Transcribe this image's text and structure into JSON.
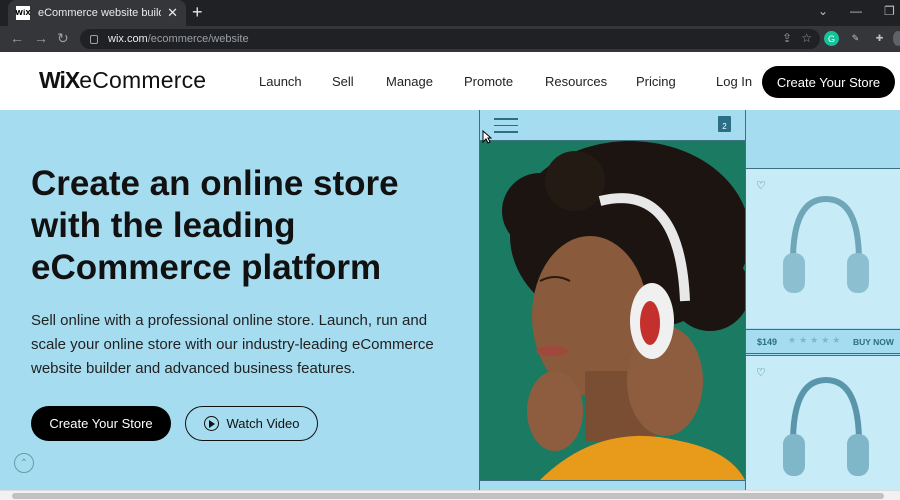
{
  "browser": {
    "tab_title": "eCommerce website builder | Cre",
    "favicon_text": "WiX",
    "tab_close": "✕",
    "new_tab": "+",
    "url_host": "wix.com",
    "url_path": "/ecommerce/website"
  },
  "header": {
    "logo_wix": "WiX",
    "logo_product": "eCommerce",
    "nav": [
      "Launch",
      "Sell",
      "Manage",
      "Promote",
      "Resources",
      "Pricing"
    ],
    "login": "Log In",
    "cta": "Create Your Store"
  },
  "hero": {
    "headline_1": "Create an online store",
    "headline_2": "with the leading",
    "headline_3": "eCommerce platform",
    "sub_1": "Sell online with a professional online store. Launch, run and",
    "sub_2": "scale your online store with our industry-leading eCommerce",
    "sub_3": "website builder and advanced business features.",
    "primary_button": "Create Your Store",
    "video_button": "Watch Video"
  },
  "phone": {
    "cart_count": "2"
  },
  "products": {
    "price_1": "$149",
    "stars": "★★★★★",
    "buy_label": "BUY NOW"
  },
  "colors": {
    "hero_bg": "#a6dcef",
    "accent": "#2a6f85",
    "cta": "#000000",
    "photo_bg": "#1a7a62"
  }
}
